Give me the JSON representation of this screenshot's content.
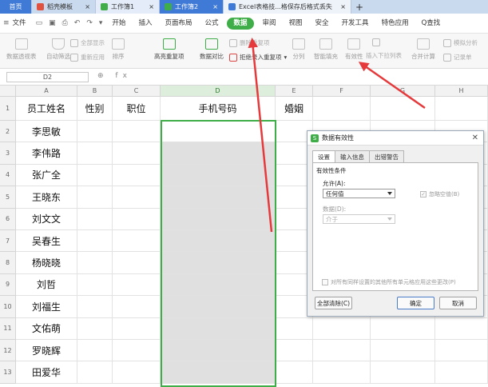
{
  "tabs": {
    "home": "首页",
    "template": "稻壳模板",
    "wb1": "工作簿1",
    "wb2": "工作簿2",
    "article": "Excel表格技...格保存后格式丢失",
    "new_tab": "+"
  },
  "menu": {
    "file": "文件",
    "items": [
      "开始",
      "插入",
      "页面布局",
      "公式",
      "数据",
      "审阅",
      "视图",
      "安全",
      "开发工具",
      "特色应用"
    ],
    "search": "Q查找"
  },
  "toolbar": {
    "pivot": "数据透视表",
    "autofilter": "自动筛选",
    "show_all": "全部显示",
    "reapply": "重新应用",
    "sort": "排序",
    "highlight_dup": "高亮重复项",
    "compare": "数据对比",
    "delete_dup": "删除重复项",
    "reject_dup": "拒绝录入重复项",
    "split": "分列",
    "smart_fill": "智能填充",
    "validity": "有效性",
    "dropdown": "插入下拉列表",
    "merge_calc": "合并计算",
    "simulate": "模拟分析",
    "record": "记录单"
  },
  "formula_bar": {
    "name_box": "D2",
    "icons": "⊕ fx",
    "value": ""
  },
  "sheet": {
    "columns": [
      "A",
      "B",
      "C",
      "D",
      "E",
      "F",
      "G",
      "H"
    ],
    "rows": [
      "1",
      "2",
      "3",
      "4",
      "5",
      "6",
      "7",
      "8",
      "9",
      "10",
      "11",
      "12",
      "13"
    ],
    "headers": {
      "a": "员工姓名",
      "b": "性别",
      "c": "职位",
      "d": "手机号码",
      "e": "婚姻"
    },
    "names": [
      "李思敏",
      "李伟路",
      "张广全",
      "王晓东",
      "刘文文",
      "吴春生",
      "杨晓晓",
      "刘哲",
      "刘福生",
      "文佑萌",
      "罗晓辉",
      "田爱华"
    ]
  },
  "dialog": {
    "title": "数据有效性",
    "tabs": [
      "设置",
      "输入信息",
      "出错警告"
    ],
    "criteria": "有效性条件",
    "allow_label": "允许(A):",
    "allow_value": "任何值",
    "ignore_blank": "忽略空值(B)",
    "data_label": "数据(D):",
    "data_value": "介于",
    "apply_all": "对所有同样设置的其他所有单元格应用这些更改(P)",
    "clear_all": "全部清除(C)",
    "ok": "确定",
    "cancel": "取消"
  },
  "colors": {
    "accent_green": "#3fae49",
    "tab_blue": "#3f7ad6",
    "arrow_red": "#e5393b"
  }
}
